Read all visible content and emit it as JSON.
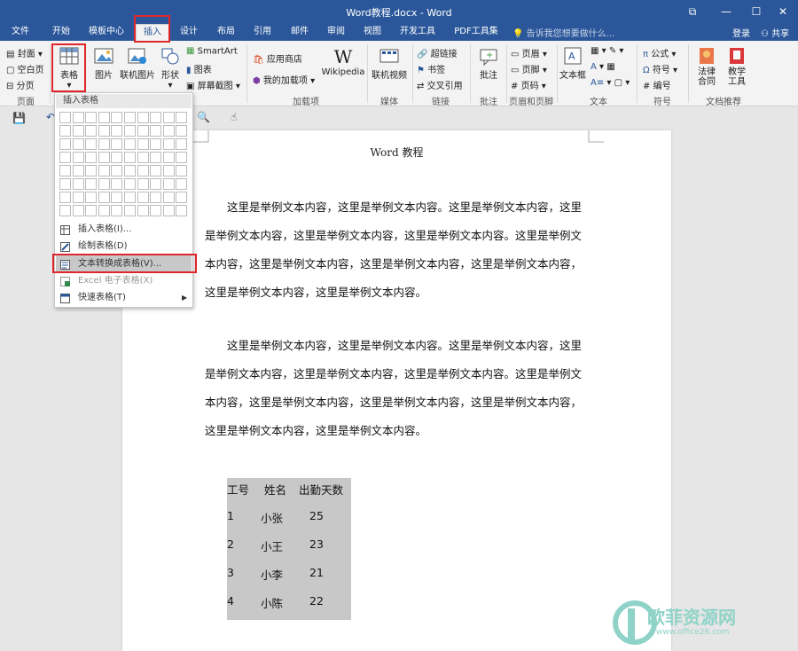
{
  "window": {
    "title": "Word教程.docx - Word",
    "buttons": {
      "restore": "⧉",
      "minimize": "—",
      "maximize": "☐",
      "close": "✕"
    }
  },
  "tabs": [
    {
      "label": "文件"
    },
    {
      "label": "开始"
    },
    {
      "label": "模板中心"
    },
    {
      "label": "插入"
    },
    {
      "label": "设计"
    },
    {
      "label": "布局"
    },
    {
      "label": "引用"
    },
    {
      "label": "邮件"
    },
    {
      "label": "审阅"
    },
    {
      "label": "视图"
    },
    {
      "label": "开发工具"
    },
    {
      "label": "PDF工具集"
    }
  ],
  "active_tab": "插入",
  "tell_me": "告诉我您想要做什么...",
  "account": {
    "login": "登录",
    "share": "共享"
  },
  "ribbon": {
    "pages": {
      "cover": "封面",
      "blank": "空白页",
      "break": "分页",
      "group": "页面"
    },
    "table": {
      "label": "表格"
    },
    "pictures": {
      "label": "图片"
    },
    "online_pictures": {
      "label": "联机图片"
    },
    "shapes": {
      "label": "形状"
    },
    "smartart": "SmartArt",
    "chart": "图表",
    "screenshot": "屏幕截图",
    "addins": {
      "store": "应用商店",
      "my_addins": "我的加载项",
      "wikipedia": "Wikipedia",
      "group": "加载项"
    },
    "media": {
      "online_video": "联机视频",
      "group": "媒体"
    },
    "links": {
      "hyperlink": "超链接",
      "bookmark": "书签",
      "cross_ref": "交叉引用",
      "group": "链接"
    },
    "comments": {
      "comment": "批注",
      "group": "批注"
    },
    "header_footer": {
      "header": "页眉",
      "footer": "页脚",
      "page_number": "页码",
      "group": "页眉和页脚"
    },
    "text": {
      "textbox": "文本框",
      "group": "文本"
    },
    "symbols": {
      "equation": "公式",
      "symbol": "符号",
      "numbering": "编号",
      "group": "符号"
    },
    "recommend": {
      "law": "法律合同",
      "teaching": "教学工具",
      "group": "文档推荐"
    }
  },
  "dropdown": {
    "header": "插入表格",
    "items": [
      {
        "label": "插入表格(I)...",
        "state": "normal"
      },
      {
        "label": "绘制表格(D)",
        "state": "normal"
      },
      {
        "label": "文本转换成表格(V)...",
        "state": "highlighted"
      },
      {
        "label": "Excel 电子表格(X)",
        "state": "disabled"
      },
      {
        "label": "快速表格(T)",
        "state": "normal",
        "submenu": true
      }
    ]
  },
  "document": {
    "title": "Word 教程",
    "paragraphs": [
      "这里是举例文本内容，这里是举例文本内容。这里是举例文本内容，这里是举例文本内容，这里是举例文本内容，这里是举例文本内容。这里是举例文本内容，这里是举例文本内容，这里是举例文本内容，这里是举例文本内容，这里是举例文本内容，这里是举例文本内容。",
      "这里是举例文本内容，这里是举例文本内容。这里是举例文本内容，这里是举例文本内容，这里是举例文本内容，这里是举例文本内容。这里是举例文本内容，这里是举例文本内容，这里是举例文本内容，这里是举例文本内容，这里是举例文本内容，这里是举例文本内容。"
    ],
    "table": {
      "headers": [
        "工号",
        "姓名",
        "出勤天数"
      ],
      "rows": [
        [
          "1",
          "小张",
          "25"
        ],
        [
          "2",
          "小王",
          "23"
        ],
        [
          "3",
          "小李",
          "21"
        ],
        [
          "4",
          "小陈",
          "22"
        ]
      ]
    }
  },
  "watermark": {
    "name": "欧菲资源网",
    "url": "www.office26.com"
  },
  "colors": {
    "accent": "#2b579a",
    "highlight_box": "#e0262b",
    "watermark": "#8fd3c8"
  }
}
